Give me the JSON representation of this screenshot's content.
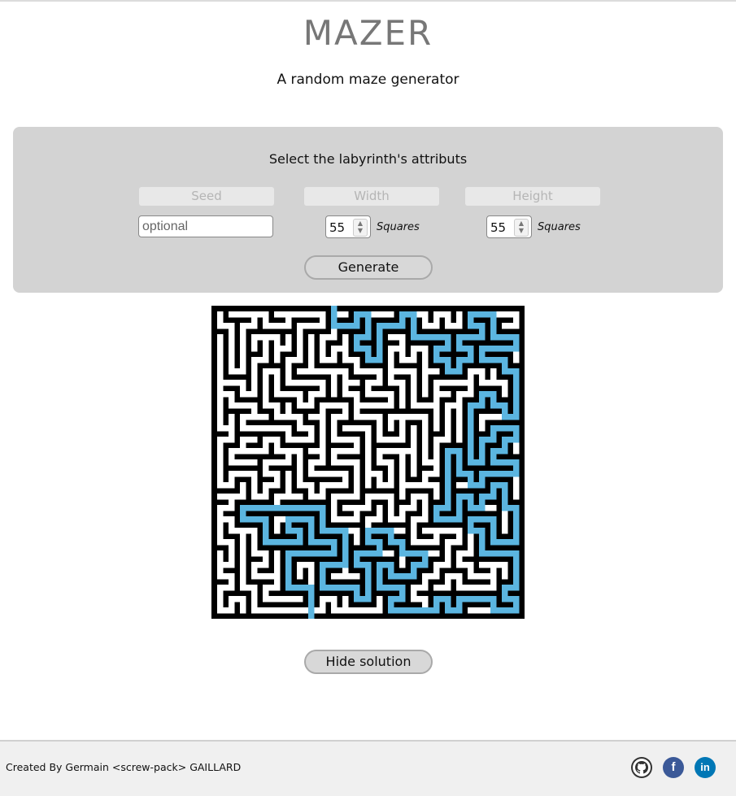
{
  "header": {
    "title": "MAZER",
    "subtitle": "A random maze generator"
  },
  "settings": {
    "heading": "Select the labyrinth's attributs",
    "seed_label": "Seed",
    "seed_placeholder": "optional",
    "seed_value": "",
    "width_label": "Width",
    "width_value": "55",
    "height_label": "Height",
    "height_value": "55",
    "unit": "Squares",
    "generate_label": "Generate"
  },
  "maze": {
    "columns": 55,
    "rows": 55,
    "wall_color": "#000000",
    "path_color": "#ffffff",
    "solution_color": "#5bb5e0",
    "solution_shown": true
  },
  "actions": {
    "toggle_solution_label": "Hide solution"
  },
  "footer": {
    "credit": "Created By Germain <screw-pack> GAILLARD",
    "links": [
      {
        "name": "github-icon",
        "color": "#333333"
      },
      {
        "name": "facebook-icon",
        "color": "#3b5998"
      },
      {
        "name": "linkedin-icon",
        "color": "#0077b5"
      }
    ]
  }
}
